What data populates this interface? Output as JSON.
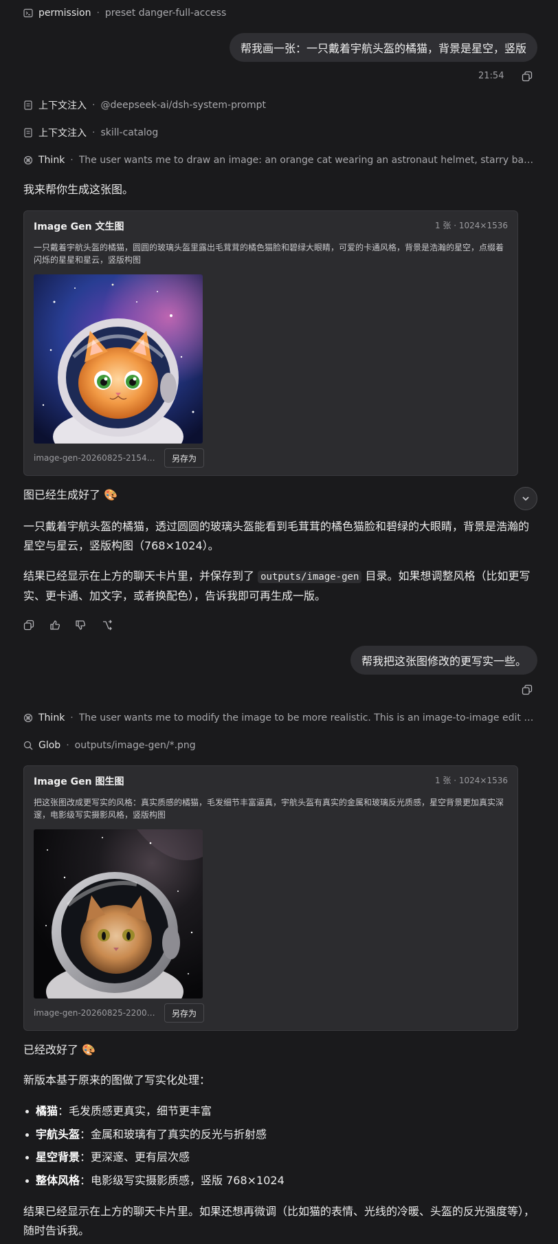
{
  "top_meta": {
    "permission_label": "permission",
    "permission_detail": "preset danger-full-access"
  },
  "msg1": {
    "user_text": "帮我画一张：一只戴着宇航头盔的橘猫，背景是星空，竖版",
    "time": "21:54"
  },
  "context1": {
    "label": "上下文注入",
    "detail": "@deepseek-ai/dsh-system-prompt"
  },
  "context2": {
    "label": "上下文注入",
    "detail": "skill-catalog"
  },
  "think1": {
    "label": "Think",
    "detail": "The user wants me to draw an image: an orange cat wearing an astronaut helmet, starry background, v..."
  },
  "reply1_intro": "我来帮你生成这张图。",
  "card1": {
    "title": "Image Gen 文生图",
    "meta": "1 张 · 1024×1536",
    "prompt": "一只戴着宇航头盔的橘猫，圆圆的玻璃头盔里露出毛茸茸的橘色猫脸和碧绿大眼睛，可爱的卡通风格，背景是浩瀚的星空，点缀着闪烁的星星和星云，竖版构图",
    "filename": "image-gen-20260825-21545...",
    "save_label": "另存为",
    "image_icon": "cartoon-astronaut-cat-image"
  },
  "reply1": {
    "done": "图已经生成好了 🎨",
    "desc": "一只戴着宇航头盔的橘猫，透过圆圆的玻璃头盔能看到毛茸茸的橘色猫脸和碧绿的大眼睛，背景是浩瀚的星空与星云，竖版构图（768×1024）。",
    "saved_pre": "结果已经显示在上方的聊天卡片里，并保存到了",
    "saved_code": "outputs/image-gen",
    "saved_post": "目录。如果想调整风格（比如更写实、更卡通、加文字，或者换配色），告诉我即可再生成一版。"
  },
  "msg2": {
    "user_text": "帮我把这张图修改的更写实一些。"
  },
  "think2": {
    "label": "Think",
    "detail": "The user wants me to modify the image to be more realistic. This is an image-to-image edit task. I sho..."
  },
  "glob": {
    "label": "Glob",
    "detail": "outputs/image-gen/*.png"
  },
  "card2": {
    "title": "Image Gen 图生图",
    "meta": "1 张 · 1024×1536",
    "prompt": "把这张图改成更写实的风格：真实质感的橘猫，毛发细节丰富逼真，宇航头盔有真实的金属和玻璃反光质感，星空背景更加真实深邃，电影级写实摄影风格，竖版构图",
    "filename": "image-gen-20260825-22004...",
    "save_label": "另存为",
    "image_icon": "realistic-astronaut-cat-image"
  },
  "reply2": {
    "done": "已经改好了 🎨",
    "intro": "新版本基于原来的图做了写实化处理：",
    "bullets": [
      {
        "key": "橘猫",
        "text": "：毛发质感更真实，细节更丰富"
      },
      {
        "key": "宇航头盔",
        "text": "：金属和玻璃有了真实的反光与折射感"
      },
      {
        "key": "星空背景",
        "text": "：更深邃、更有层次感"
      },
      {
        "key": "整体风格",
        "text": "：电影级写实摄影质感，竖版 768×1024"
      }
    ],
    "closing": "结果已经显示在上方的聊天卡片里。如果还想再微调（比如猫的表情、光线的冷暖、头盔的反光强度等），随时告诉我。"
  },
  "colors": {
    "background": "#1a1a1c",
    "bubble": "#2f2f33",
    "card": "#2c2c2f",
    "muted_text": "#a9a9ad"
  }
}
